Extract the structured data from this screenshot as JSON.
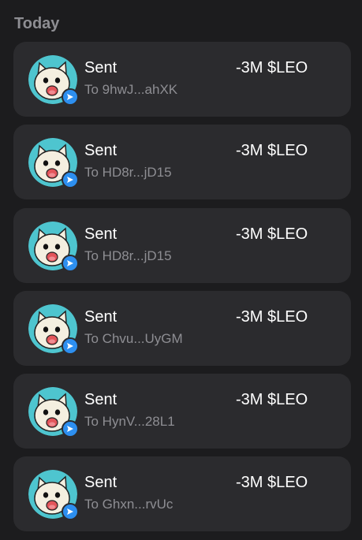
{
  "section": {
    "title": "Today"
  },
  "colors": {
    "background": "#1c1c1e",
    "card": "#2b2b2e",
    "avatar_bg": "#4ec5cf",
    "badge": "#2d8ff0",
    "secondary_text": "#8e8e93"
  },
  "transactions": [
    {
      "title": "Sent",
      "subtitle": "To 9hwJ...ahXK",
      "amount": "-3M $LEO",
      "icon": "cat-avatar-icon",
      "badge_icon": "send-arrow-icon"
    },
    {
      "title": "Sent",
      "subtitle": "To HD8r...jD15",
      "amount": "-3M $LEO",
      "icon": "cat-avatar-icon",
      "badge_icon": "send-arrow-icon"
    },
    {
      "title": "Sent",
      "subtitle": "To HD8r...jD15",
      "amount": "-3M $LEO",
      "icon": "cat-avatar-icon",
      "badge_icon": "send-arrow-icon"
    },
    {
      "title": "Sent",
      "subtitle": "To Chvu...UyGM",
      "amount": "-3M $LEO",
      "icon": "cat-avatar-icon",
      "badge_icon": "send-arrow-icon"
    },
    {
      "title": "Sent",
      "subtitle": "To HynV...28L1",
      "amount": "-3M $LEO",
      "icon": "cat-avatar-icon",
      "badge_icon": "send-arrow-icon"
    },
    {
      "title": "Sent",
      "subtitle": "To Ghxn...rvUc",
      "amount": "-3M $LEO",
      "icon": "cat-avatar-icon",
      "badge_icon": "send-arrow-icon"
    }
  ]
}
